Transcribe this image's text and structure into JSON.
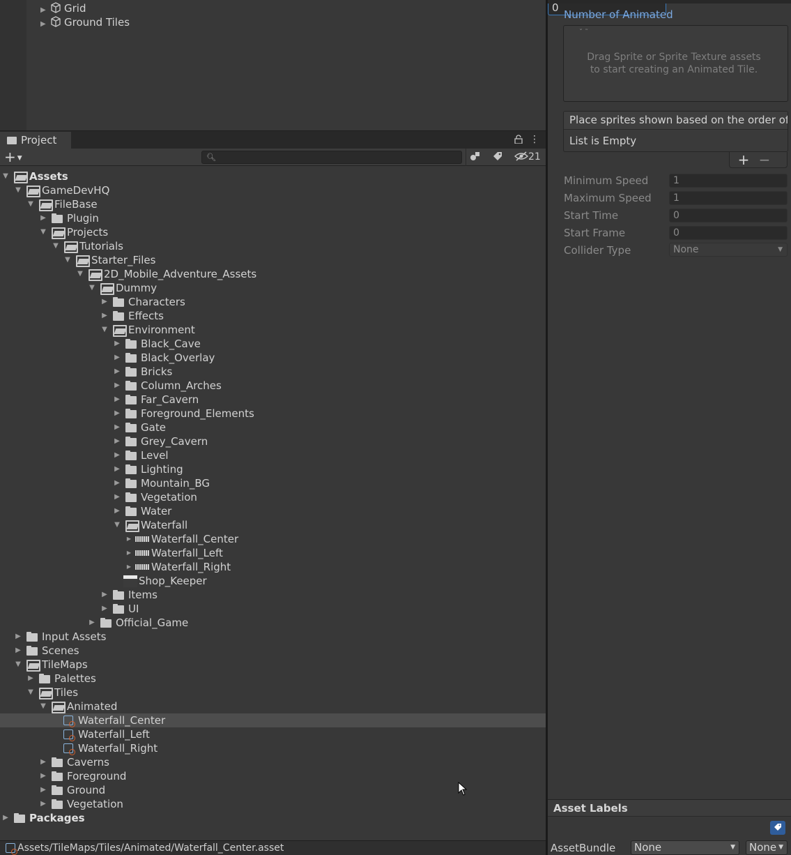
{
  "hierarchy": {
    "items": [
      {
        "label": "Grid"
      },
      {
        "label": "Ground Tiles"
      }
    ]
  },
  "project": {
    "tab_label": "Project",
    "toolbar": {
      "create_label": "+",
      "search_placeholder": "",
      "hidden_count": "21"
    },
    "tree": [
      {
        "label": "Assets"
      },
      {
        "label": "GameDevHQ"
      },
      {
        "label": "FileBase"
      },
      {
        "label": "Plugin"
      },
      {
        "label": "Projects"
      },
      {
        "label": "Tutorials"
      },
      {
        "label": "Starter_Files"
      },
      {
        "label": "2D_Mobile_Adventure_Assets"
      },
      {
        "label": "Dummy"
      },
      {
        "label": "Characters"
      },
      {
        "label": "Effects"
      },
      {
        "label": "Environment"
      },
      {
        "label": "Black_Cave"
      },
      {
        "label": "Black_Overlay"
      },
      {
        "label": "Bricks"
      },
      {
        "label": "Column_Arches"
      },
      {
        "label": "Far_Cavern"
      },
      {
        "label": "Foreground_Elements"
      },
      {
        "label": "Gate"
      },
      {
        "label": "Grey_Cavern"
      },
      {
        "label": "Level"
      },
      {
        "label": "Lighting"
      },
      {
        "label": "Mountain_BG"
      },
      {
        "label": "Vegetation"
      },
      {
        "label": "Water"
      },
      {
        "label": "Waterfall"
      },
      {
        "label": "Waterfall_Center"
      },
      {
        "label": "Waterfall_Left"
      },
      {
        "label": "Waterfall_Right"
      },
      {
        "label": "Shop_Keeper"
      },
      {
        "label": "Items"
      },
      {
        "label": "UI"
      },
      {
        "label": "Official_Game"
      },
      {
        "label": "Input Assets"
      },
      {
        "label": "Scenes"
      },
      {
        "label": "TileMaps"
      },
      {
        "label": "Palettes"
      },
      {
        "label": "Tiles"
      },
      {
        "label": "Animated"
      },
      {
        "label": "Waterfall_Center"
      },
      {
        "label": "Waterfall_Left"
      },
      {
        "label": "Waterfall_Right"
      },
      {
        "label": "Caverns"
      },
      {
        "label": "Foreground"
      },
      {
        "label": "Ground"
      },
      {
        "label": "Vegetation"
      },
      {
        "label": "Packages"
      }
    ],
    "status_path": "Assets/TileMaps/Tiles/Animated/Waterfall_Center.asset"
  },
  "inspector": {
    "number_of_animated_label": "Number of Animated",
    "number_of_animated_value": "0",
    "dropzone_text": "Drag Sprite or Sprite Texture assets\nto start creating an Animated Tile.",
    "order_header": "Place sprites shown based on the order of",
    "list_empty": "List is Empty",
    "add_label": "+",
    "remove_label": "−",
    "fields": [
      {
        "label": "Minimum Speed",
        "value": "1"
      },
      {
        "label": "Maximum Speed",
        "value": "1"
      },
      {
        "label": "Start Time",
        "value": "0"
      },
      {
        "label": "Start Frame",
        "value": "0"
      },
      {
        "label": "Collider Type",
        "value": "None"
      }
    ],
    "asset_labels_title": "Asset Labels",
    "assetbundle_label": "AssetBundle",
    "assetbundle_value": "None",
    "assetbundle_variant": "None"
  }
}
